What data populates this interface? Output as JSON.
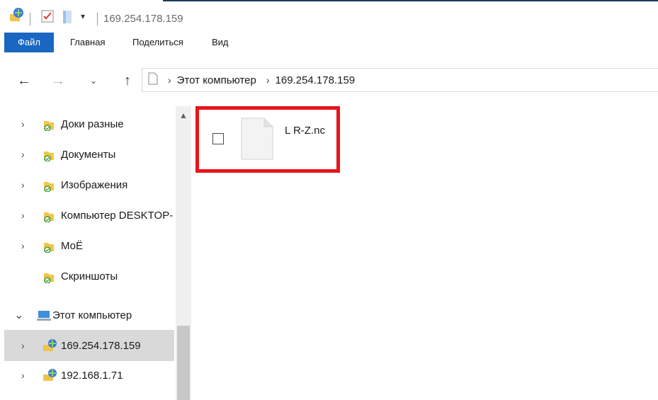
{
  "qat": {
    "title": "169.254.178.159"
  },
  "ribbon": {
    "tabs": [
      "Файл",
      "Главная",
      "Поделиться",
      "Вид"
    ]
  },
  "address": {
    "crumbs": [
      "Этот компьютер",
      "169.254.178.159"
    ]
  },
  "tree": {
    "items": [
      {
        "label": "Доки разные"
      },
      {
        "label": "Документы"
      },
      {
        "label": "Изображения"
      },
      {
        "label": "Компьютер DESKTOP-"
      },
      {
        "label": "МоЁ"
      },
      {
        "label": "Скриншоты"
      },
      {
        "label": "Этот компьютер"
      },
      {
        "label": "169.254.178.159"
      },
      {
        "label": "192.168.1.71"
      }
    ]
  },
  "files": [
    {
      "name": "L R-Z.nc"
    }
  ],
  "colors": {
    "accent": "#1967c0",
    "highlight": "#e8141b",
    "selected": "#d9d9d9"
  },
  "icons": {
    "folder": "folder-icon",
    "network_drive": "network-drive-icon",
    "computer": "computer-icon",
    "file": "file-icon"
  }
}
